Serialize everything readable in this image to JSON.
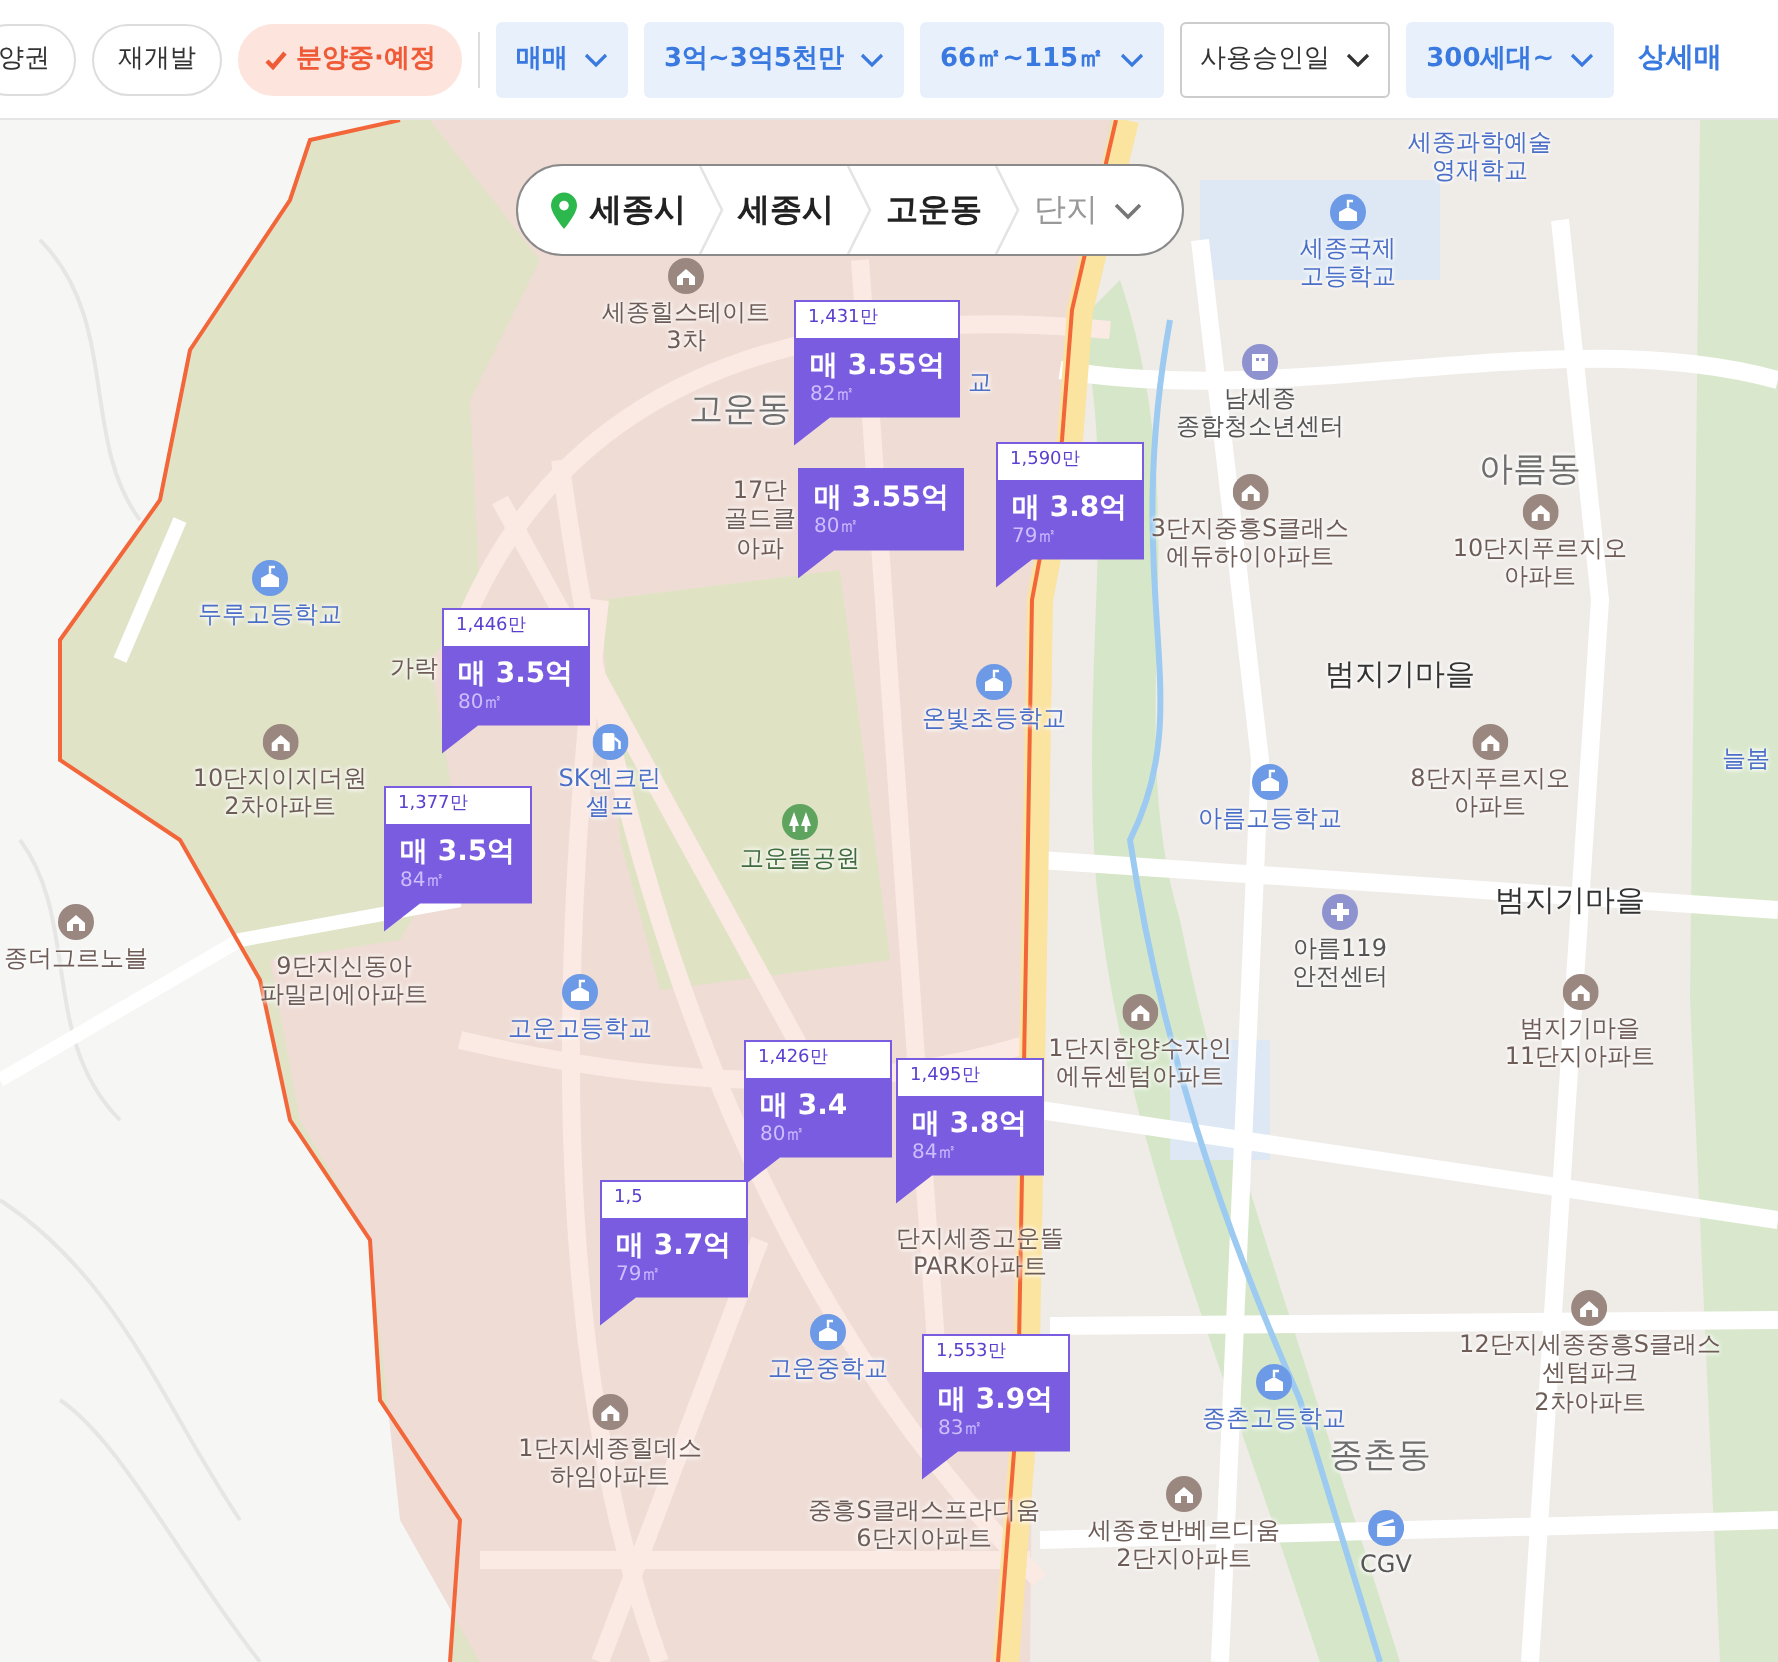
{
  "filters": [
    {
      "kind": "toggle",
      "label": "양권",
      "selected": false
    },
    {
      "kind": "toggle",
      "label": "재개발",
      "selected": false
    },
    {
      "kind": "toggle",
      "label": "분양중·예정",
      "selected": true
    },
    {
      "kind": "dropdown",
      "label": "매매",
      "active": true
    },
    {
      "kind": "dropdown",
      "label": "3억~3억5천만",
      "active": true
    },
    {
      "kind": "dropdown",
      "label": "66㎡~115㎡",
      "active": true
    },
    {
      "kind": "dropdown",
      "label": "사용승인일",
      "active": false
    },
    {
      "kind": "dropdown",
      "label": "300세대~",
      "active": true
    },
    {
      "kind": "link",
      "label": "상세매"
    }
  ],
  "breadcrumb": [
    {
      "kind": "level",
      "label": "세종시"
    },
    {
      "kind": "level",
      "label": "세종시"
    },
    {
      "kind": "level",
      "label": "고운동"
    },
    {
      "kind": "dropdown",
      "label": "단지"
    }
  ],
  "map_labels": [
    {
      "kind": "school",
      "icon": false,
      "lines": [
        "세종과학예술",
        "영재학교"
      ]
    },
    {
      "kind": "school",
      "icon": true,
      "lines": [
        "세종국제",
        "고등학교"
      ]
    },
    {
      "kind": "community",
      "icon": true,
      "lines": [
        "남세종",
        "종합청소년센터"
      ]
    },
    {
      "kind": "district",
      "lines": [
        "아름동"
      ]
    },
    {
      "kind": "apartment",
      "icon": true,
      "lines": [
        "3단지중흥S클래스",
        "에듀하이아파트"
      ]
    },
    {
      "kind": "apartment",
      "icon": true,
      "lines": [
        "10단지푸르지오",
        "아파트"
      ]
    },
    {
      "kind": "village",
      "lines": [
        "범지기마을"
      ]
    },
    {
      "kind": "apartment",
      "icon": true,
      "lines": [
        "8단지푸르지오",
        "아파트"
      ]
    },
    {
      "kind": "school",
      "icon": true,
      "lines": [
        "아름고등학교"
      ]
    },
    {
      "kind": "school",
      "icon": false,
      "lines": [
        "늘봄"
      ]
    },
    {
      "kind": "village",
      "lines": [
        "범지기마을"
      ]
    },
    {
      "kind": "fire",
      "icon": true,
      "lines": [
        "아름119",
        "안전센터"
      ]
    },
    {
      "kind": "apartment",
      "icon": true,
      "lines": [
        "범지기마을",
        "11단지아파트"
      ]
    },
    {
      "kind": "apartment",
      "icon": true,
      "lines": [
        "1단지한양수자인",
        "에듀센텀아파트"
      ]
    },
    {
      "kind": "apartment",
      "icon": true,
      "lines": [
        "12단지세종중흥S클래스",
        "센텀파크",
        "2차아파트"
      ]
    },
    {
      "kind": "school",
      "icon": true,
      "lines": [
        "종촌고등학교"
      ]
    },
    {
      "kind": "district",
      "lines": [
        "종촌동"
      ]
    },
    {
      "kind": "apartment",
      "icon": true,
      "lines": [
        "세종호반베르디움",
        "2단지아파트"
      ]
    },
    {
      "kind": "cinema",
      "icon": true,
      "lines": [
        "CGV"
      ]
    },
    {
      "kind": "apartment",
      "icon": true,
      "lines": [
        "종더그르노블"
      ]
    },
    {
      "kind": "apartment",
      "icon": true,
      "lines": [
        "세종힐스테이트",
        "3차"
      ]
    },
    {
      "kind": "district",
      "lines": [
        "고운동"
      ]
    },
    {
      "kind": "school",
      "icon": false,
      "lines": [
        "교"
      ]
    },
    {
      "kind": "apartment",
      "icon": false,
      "lines": [
        "17단",
        "골드클",
        "아파"
      ]
    },
    {
      "kind": "school",
      "icon": true,
      "lines": [
        "두루고등학교"
      ]
    },
    {
      "kind": "apartment",
      "icon": false,
      "lines": [
        "가락"
      ]
    },
    {
      "kind": "apartment",
      "icon": true,
      "lines": [
        "10단지이지더원",
        "2차아파트"
      ]
    },
    {
      "kind": "gas",
      "icon": true,
      "lines": [
        "SK엔크린",
        "셀프"
      ]
    },
    {
      "kind": "school",
      "icon": true,
      "lines": [
        "온빛초등학교"
      ]
    },
    {
      "kind": "park",
      "icon": true,
      "lines": [
        "고운뜰공원"
      ]
    },
    {
      "kind": "apartment",
      "icon": false,
      "lines": [
        "9단지신동아",
        "파밀리에아파트"
      ]
    },
    {
      "kind": "school",
      "icon": true,
      "lines": [
        "고운고등학교"
      ]
    },
    {
      "kind": "apartment",
      "icon": false,
      "lines": [
        "단지세종고운뜰",
        "PARK아파트"
      ]
    },
    {
      "kind": "school",
      "icon": true,
      "lines": [
        "고운중학교"
      ]
    },
    {
      "kind": "apartment",
      "icon": true,
      "lines": [
        "1단지세종힐데스",
        "하임아파트"
      ]
    },
    {
      "kind": "apartment",
      "icon": false,
      "lines": [
        "중흥S클래스프라디움",
        "6단지아파트"
      ]
    }
  ],
  "price_markers": [
    {
      "unit_price": "1,431만",
      "price": "매 3.55억",
      "area": "82㎡"
    },
    {
      "price": "매 3.55억",
      "area": "80㎡"
    },
    {
      "unit_price": "1,590만",
      "price": "매 3.8억",
      "area": "79㎡"
    },
    {
      "unit_price": "1,446만",
      "price": "매 3.5억",
      "area": "80㎡"
    },
    {
      "unit_price": "1,377만",
      "price": "매 3.5억",
      "area": "84㎡"
    },
    {
      "unit_price": "1,426만",
      "price": "매 3.4",
      "area": "80㎡"
    },
    {
      "unit_price": "1,495만",
      "price": "매 3.8억",
      "area": "84㎡"
    },
    {
      "unit_price": "1,5",
      "price": "매 3.7억",
      "area": "79㎡"
    },
    {
      "unit_price": "1,553만",
      "price": "매 3.9억",
      "area": "83㎡"
    }
  ]
}
